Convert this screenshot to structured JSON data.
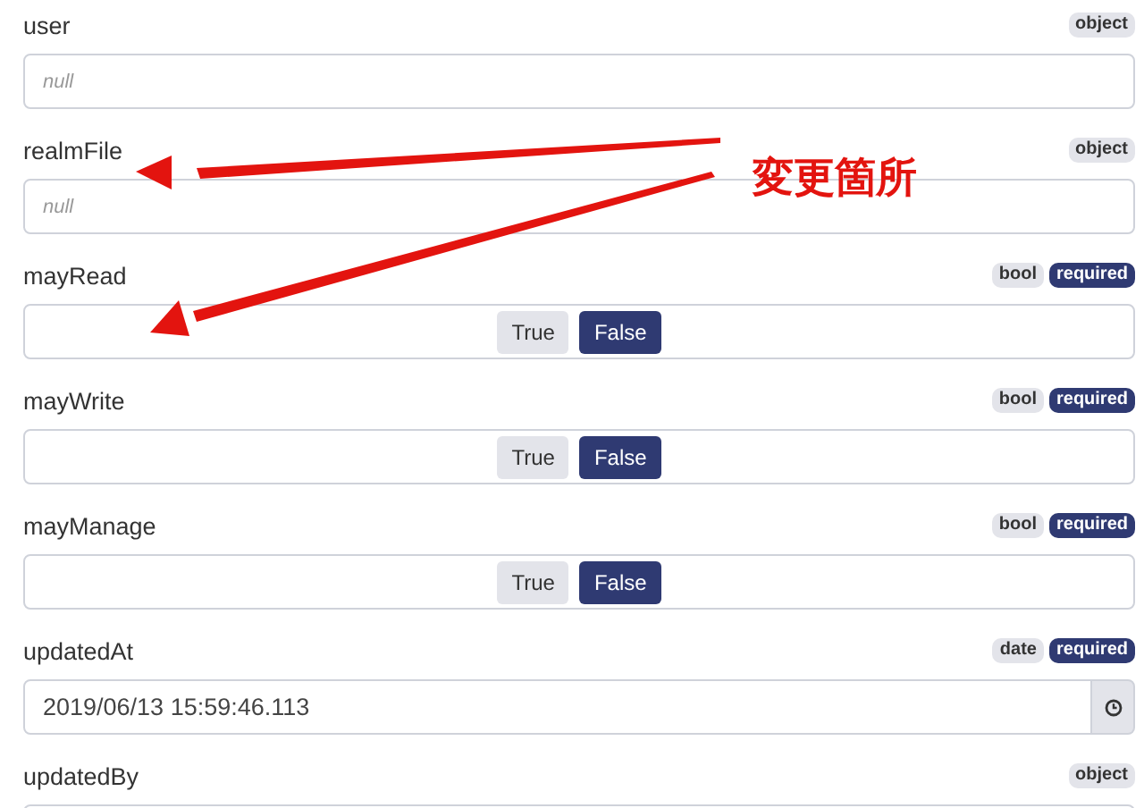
{
  "fields": [
    {
      "label": "user",
      "kind": "text",
      "placeholder": "null",
      "tags": [
        {
          "text": "object",
          "kind": "type"
        }
      ]
    },
    {
      "label": "realmFile",
      "kind": "text",
      "placeholder": "null",
      "tags": [
        {
          "text": "object",
          "kind": "type"
        }
      ]
    },
    {
      "label": "mayRead",
      "kind": "bool",
      "options": [
        {
          "label": "True",
          "selected": false
        },
        {
          "label": "False",
          "selected": true
        }
      ],
      "tags": [
        {
          "text": "bool",
          "kind": "type"
        },
        {
          "text": "required",
          "kind": "required"
        }
      ]
    },
    {
      "label": "mayWrite",
      "kind": "bool",
      "options": [
        {
          "label": "True",
          "selected": false
        },
        {
          "label": "False",
          "selected": true
        }
      ],
      "tags": [
        {
          "text": "bool",
          "kind": "type"
        },
        {
          "text": "required",
          "kind": "required"
        }
      ]
    },
    {
      "label": "mayManage",
      "kind": "bool",
      "options": [
        {
          "label": "True",
          "selected": false
        },
        {
          "label": "False",
          "selected": true
        }
      ],
      "tags": [
        {
          "text": "bool",
          "kind": "type"
        },
        {
          "text": "required",
          "kind": "required"
        }
      ]
    },
    {
      "label": "updatedAt",
      "kind": "date",
      "value": "2019/06/13 15:59:46.113",
      "tags": [
        {
          "text": "date",
          "kind": "type"
        },
        {
          "text": "required",
          "kind": "required"
        }
      ]
    },
    {
      "label": "updatedBy",
      "kind": "text",
      "tags": [
        {
          "text": "object",
          "kind": "type"
        }
      ]
    }
  ],
  "annotation": {
    "text": "変更箇所"
  }
}
